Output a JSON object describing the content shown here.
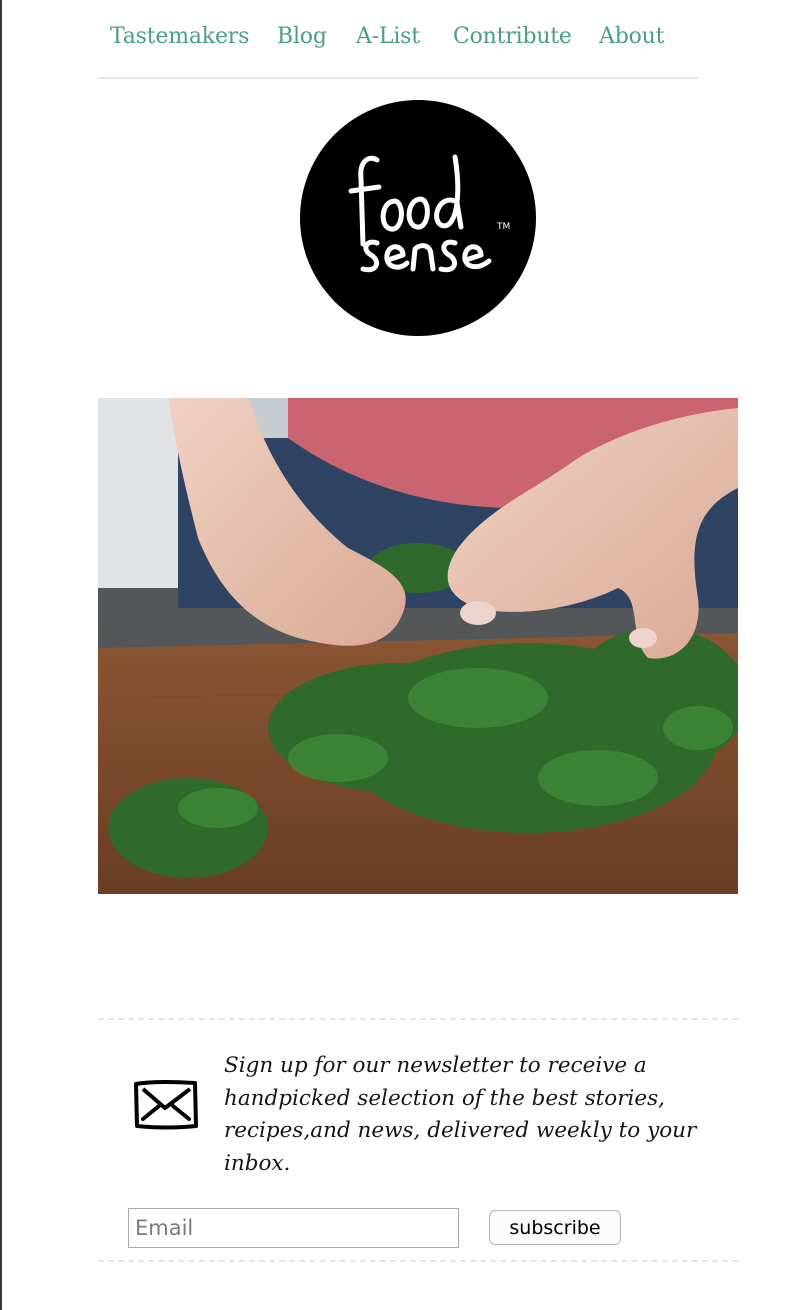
{
  "nav": {
    "items": [
      {
        "label": "Tastemakers"
      },
      {
        "label": "Blog"
      },
      {
        "label": "A-List"
      },
      {
        "label": "Contribute"
      },
      {
        "label": "About"
      }
    ]
  },
  "logo": {
    "text_line1": "food",
    "text_line2": "sense",
    "trademark": "TM"
  },
  "hero": {
    "icon": "photo-hands-picking-parsley"
  },
  "newsletter": {
    "icon": "envelope-icon",
    "text": "Sign up for our newsletter to receive a handpicked selection of the best stories, recipes,and news, delivered weekly to your inbox.",
    "email_placeholder": "Email",
    "subscribe_label": "subscribe"
  },
  "colors": {
    "nav_link": "#4a9e88",
    "logo_bg": "#000000",
    "divider": "#e4e4e4"
  }
}
